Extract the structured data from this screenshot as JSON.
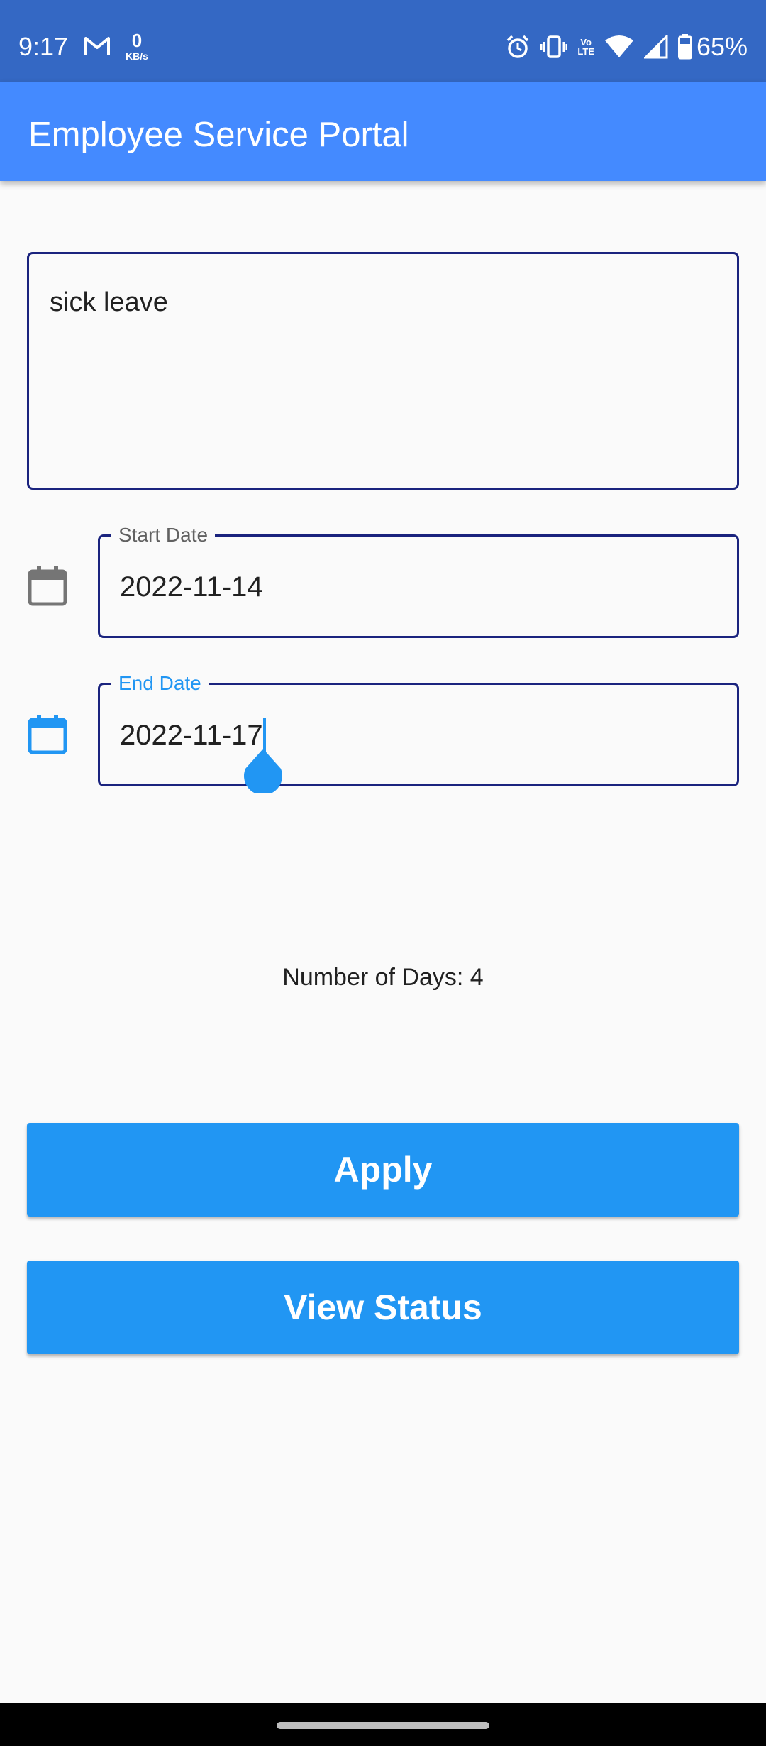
{
  "status_bar": {
    "time": "9:17",
    "net_speed_value": "0",
    "net_speed_unit": "KB/s",
    "volte_line1": "Vo",
    "volte_line2": "LTE",
    "battery_percent": "65%",
    "icons": [
      "gmail-icon",
      "alarm-icon",
      "vibrate-icon",
      "volte-icon",
      "wifi-icon",
      "signal-icon",
      "battery-icon"
    ]
  },
  "app_bar": {
    "title": "Employee Service Portal"
  },
  "form": {
    "reason": {
      "value": "sick leave"
    },
    "start_date": {
      "label": "Start Date",
      "value": "2022-11-14",
      "icon": "calendar-icon",
      "focused": false
    },
    "end_date": {
      "label": "End Date",
      "value": "2022-11-17",
      "icon": "calendar-icon",
      "focused": true
    }
  },
  "summary": {
    "days_text": "Number of Days: 4"
  },
  "buttons": {
    "apply_label": "Apply",
    "view_status_label": "View Status"
  },
  "colors": {
    "status_bar": "#3468c4",
    "app_bar": "#448aff",
    "accent": "#2196f3",
    "field_border": "#1a237e",
    "background": "#fafafa"
  }
}
